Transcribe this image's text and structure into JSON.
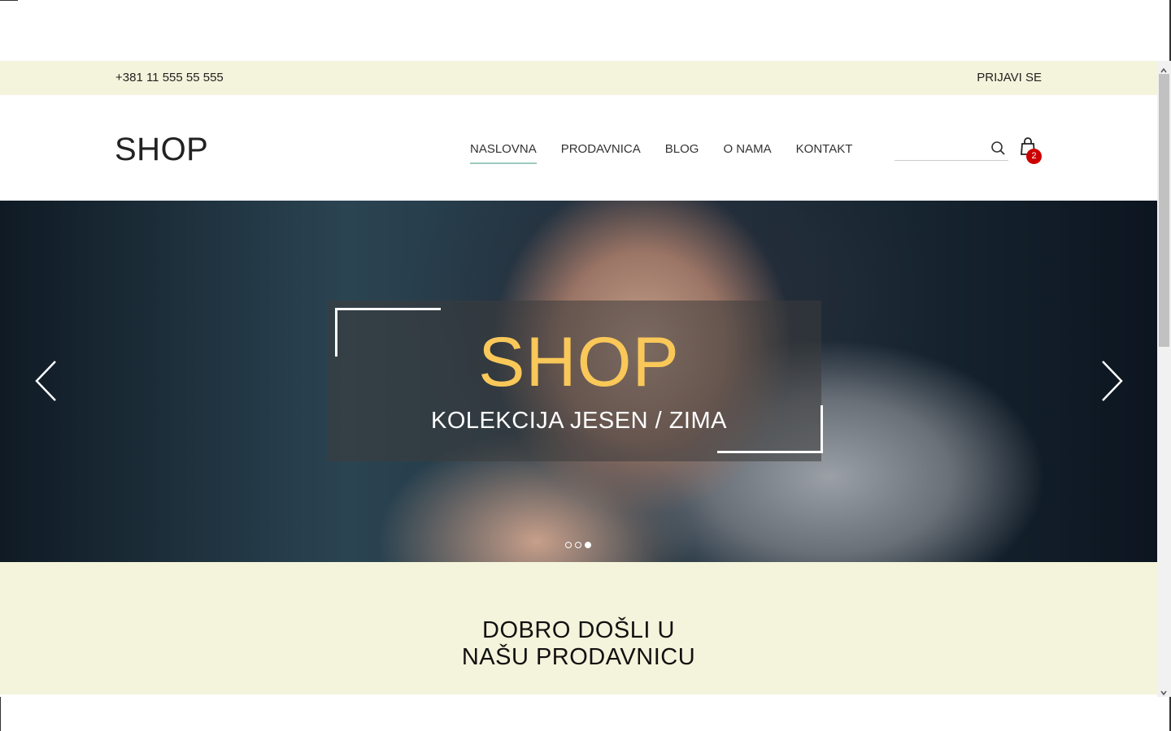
{
  "topbar": {
    "phone": "+381 11 555 55 555",
    "login_label": "PRIJAVI SE"
  },
  "header": {
    "logo": "SHOP",
    "nav": [
      {
        "label": "NASLOVNA",
        "active": true
      },
      {
        "label": "PRODAVNICA",
        "active": false
      },
      {
        "label": "BLOG",
        "active": false
      },
      {
        "label": "O NAMA",
        "active": false
      },
      {
        "label": "KONTAKT",
        "active": false
      }
    ],
    "search": {
      "placeholder": "",
      "value": ""
    },
    "cart": {
      "count": "2"
    }
  },
  "hero": {
    "title": "SHOP",
    "subtitle": "KOLEKCIJA JESEN / ZIMA",
    "slides": 3,
    "active_slide": 3
  },
  "welcome": {
    "line1": "DOBRO DOŠLI U",
    "line2": "NAŠU PRODAVNICU"
  },
  "colors": {
    "accent_title": "#f9c859",
    "band_bg": "#f4f4dc",
    "nav_underline": "#9fc9c0",
    "badge": "#cc0000"
  },
  "icons": [
    "search-icon",
    "cart-icon",
    "chevron-left-icon",
    "chevron-right-icon",
    "scroll-up-icon",
    "scroll-down-icon"
  ]
}
